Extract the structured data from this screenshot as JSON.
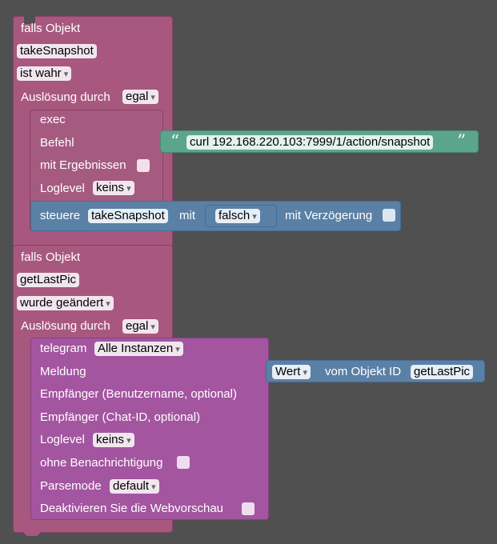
{
  "trigger1": {
    "title": "falls Objekt",
    "object": "takeSnapshot",
    "condition": "ist wahr",
    "trigger_label": "Auslösung durch",
    "trigger_value": "egal"
  },
  "exec": {
    "title": "exec",
    "command_label": "Befehl",
    "command_value": "curl 192.168.220.103:7999/1/action/snapshot",
    "with_results_label": "mit Ergebnissen",
    "loglevel_label": "Loglevel",
    "loglevel_value": "keins"
  },
  "control": {
    "prefix": "steuere",
    "object": "takeSnapshot",
    "with_label": "mit",
    "value": "falsch",
    "delay_label": "mit Verzögerung"
  },
  "trigger2": {
    "title": "falls Objekt",
    "object": "getLastPic",
    "condition": "wurde geändert",
    "trigger_label": "Auslösung durch",
    "trigger_value": "egal"
  },
  "telegram": {
    "title": "telegram",
    "instance": "Alle Instanzen",
    "message_label": "Meldung",
    "recipient_user_label": "Empfänger (Benutzername, optional)",
    "recipient_chat_label": "Empfänger (Chat-ID, optional)",
    "loglevel_label": "Loglevel",
    "loglevel_value": "keins",
    "silent_label": "ohne Benachrichtigung",
    "parsemode_label": "Parsemode",
    "parsemode_value": "default",
    "webpreview_label": "Deaktivieren Sie die Webvorschau"
  },
  "value_block": {
    "attribute": "Wert",
    "of_label": "vom Objekt ID",
    "object": "getLastPic"
  },
  "colors": {
    "workspace": "#505050",
    "trigger": "#a8587f",
    "exec": "#a55b80",
    "control": "#5b80a5",
    "telegram": "#a355a0",
    "text": "#5ba58c"
  }
}
